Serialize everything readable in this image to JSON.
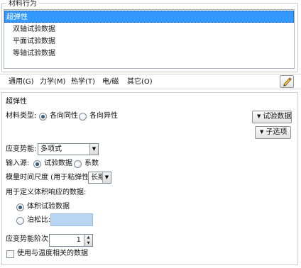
{
  "material_behaviors": {
    "title": "材料行为",
    "items": [
      {
        "label": "超弹性",
        "selected": true
      },
      {
        "label": "双轴试验数据",
        "selected": false
      },
      {
        "label": "平面试验数据",
        "selected": false
      },
      {
        "label": "等轴试验数据",
        "selected": false
      }
    ]
  },
  "menubar": {
    "items": [
      "通用(G)",
      "力学(M)",
      "热学(T)",
      "电/磁",
      "其它(O)"
    ],
    "edit_icon": "pencil-icon"
  },
  "hyperelastic": {
    "title": "超弹性",
    "material_type": {
      "label": "材料类型:",
      "options": [
        "各向同性",
        "各向异性"
      ],
      "selected": "各向同性"
    },
    "test_data_button": "试验数据",
    "suboptions_button": "子选项",
    "strain_energy": {
      "label": "应变势能:",
      "value": "多项式"
    },
    "input_source": {
      "label": "输入源:",
      "options": [
        "试验数据",
        "系数"
      ],
      "selected": "试验数据"
    },
    "time_scale": {
      "label": "模量时间尺度 (用于粘弹性):",
      "value": "长期"
    },
    "volumetric": {
      "label": "用于定义体积响应的数据:",
      "options": [
        "体积试验数据",
        "泊松比:"
      ],
      "selected": "体积试验数据",
      "poisson_value": ""
    },
    "strain_order": {
      "label": "应变势能阶次:",
      "value": "1"
    },
    "temperature_dependent": {
      "label": "使用与温度相关的数据",
      "checked": false
    }
  }
}
